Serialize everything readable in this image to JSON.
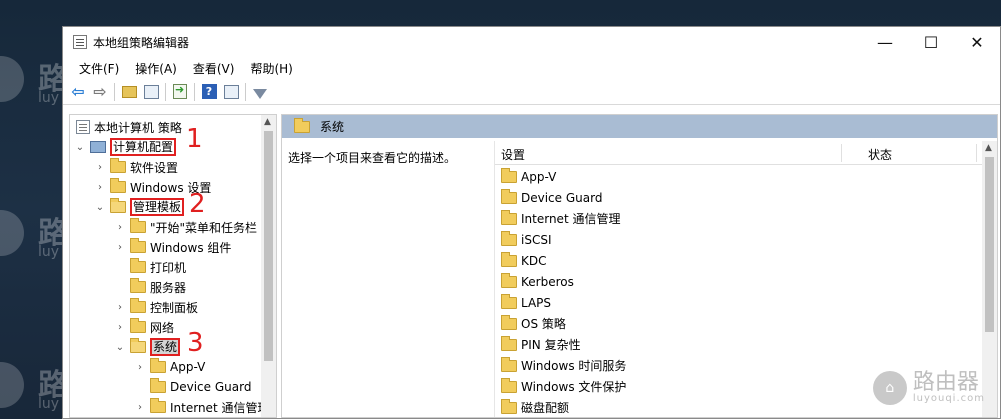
{
  "window": {
    "title": "本地组策略编辑器",
    "controls": {
      "minimize": "—",
      "maximize": "☐",
      "close": "✕"
    }
  },
  "menu": [
    "文件(F)",
    "操作(A)",
    "查看(V)",
    "帮助(H)"
  ],
  "toolbar_icons": [
    "back-icon",
    "forward-icon",
    "up-folder-icon",
    "show-hide-tree-icon",
    "export-list-icon",
    "help-icon",
    "properties-icon",
    "filter-icon"
  ],
  "tree": {
    "root": "本地计算机 策略",
    "computer_config": "计算机配置",
    "software_settings": "软件设置",
    "windows_settings": "Windows 设置",
    "admin_templates": "管理模板",
    "start_menu": "\"开始\"菜单和任务栏",
    "windows_components": "Windows 组件",
    "printers": "打印机",
    "servers": "服务器",
    "control_panel": "控制面板",
    "network": "网络",
    "system": "系统",
    "appv": "App-V",
    "device_guard": "Device Guard",
    "internet_comm": "Internet 通信管理"
  },
  "annotations": {
    "step1": "1",
    "step2": "2",
    "step3": "3"
  },
  "right": {
    "header_title": "系统",
    "description": "选择一个项目来查看它的描述。",
    "col_setting": "设置",
    "col_status": "状态",
    "items": [
      "App-V",
      "Device Guard",
      "Internet 通信管理",
      "iSCSI",
      "KDC",
      "Kerberos",
      "LAPS",
      "OS 策略",
      "PIN 复杂性",
      "Windows 时间服务",
      "Windows 文件保护",
      "磁盘配额"
    ]
  },
  "watermark": {
    "brand": "路",
    "sub": "luy"
  },
  "corner_logo": {
    "title": "路由器",
    "subtitle": "luyouqi.com"
  }
}
